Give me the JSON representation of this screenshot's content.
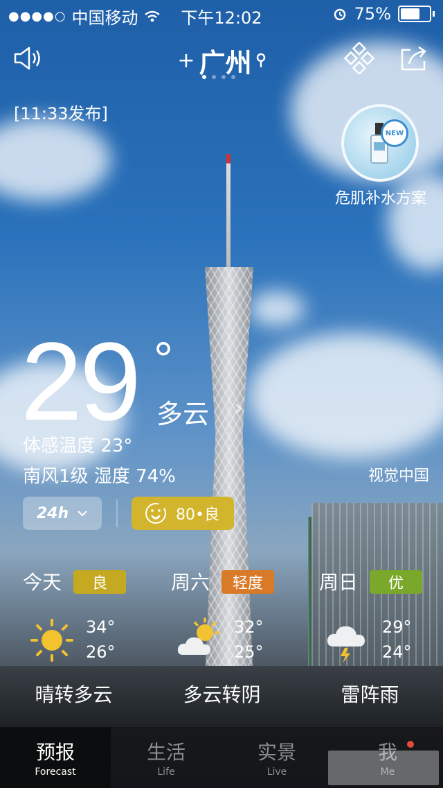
{
  "status_bar": {
    "carrier": "中国移动",
    "time": "下午12:02",
    "battery": "75%",
    "battery_level": 0.75
  },
  "header": {
    "city": "广州",
    "page_count": 4,
    "active_page": 1
  },
  "publish_time": "[11:33发布]",
  "ad": {
    "badge": "NEW",
    "label": "危肌补水方案"
  },
  "current": {
    "temperature": "29",
    "degree": "°",
    "condition": "多云",
    "feels_like": "体感温度 23°",
    "wind_humidity": "南风1级  湿度 74%",
    "photo_credit": "视觉中国"
  },
  "controls": {
    "hourly_label": "24h",
    "aqi_label": "80•良",
    "aqi_color": "#d2b52d"
  },
  "forecast": [
    {
      "day": "今天",
      "aqi": "良",
      "aqi_color": "#c4a921",
      "icon": "sunny-icon",
      "high": "34°",
      "low": "26°",
      "desc": "晴转多云"
    },
    {
      "day": "周六",
      "aqi": "轻度",
      "aqi_color": "#d97a28",
      "icon": "partly-cloudy-icon",
      "high": "32°",
      "low": "25°",
      "desc": "多云转阴"
    },
    {
      "day": "周日",
      "aqi": "优",
      "aqi_color": "#7aa82b",
      "icon": "thunderstorm-icon",
      "high": "29°",
      "low": "24°",
      "desc": "雷阵雨"
    }
  ],
  "tabs": [
    {
      "cn": "预报",
      "en": "Forecast",
      "active": true
    },
    {
      "cn": "生活",
      "en": "Life",
      "active": false
    },
    {
      "cn": "实景",
      "en": "Live",
      "active": false
    },
    {
      "cn": "我",
      "en": "Me",
      "active": false
    }
  ]
}
